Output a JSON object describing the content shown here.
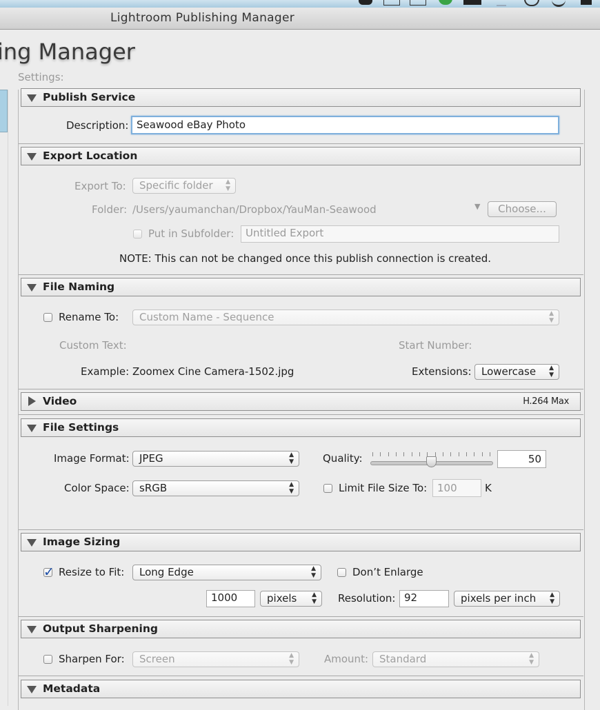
{
  "window": {
    "title": "Lightroom Publishing Manager",
    "big_title": "ing Manager",
    "settings_label": "Settings:"
  },
  "publish_service": {
    "header": "Publish Service",
    "description_label": "Description:",
    "description_value": "Seawood eBay Photo"
  },
  "export_location": {
    "header": "Export Location",
    "export_to_label": "Export To:",
    "export_to_value": "Specific folder",
    "folder_label": "Folder:",
    "folder_path": "/Users/yaumanchan/Dropbox/YauMan-Seawood",
    "choose_button": "Choose...",
    "subfolder_label": "Put in Subfolder:",
    "subfolder_value": "Untitled Export",
    "note": "NOTE: This can not be changed once this publish connection is created."
  },
  "file_naming": {
    "header": "File Naming",
    "rename_label": "Rename To:",
    "rename_value": "Custom Name - Sequence",
    "custom_text_label": "Custom Text:",
    "start_number_label": "Start Number:",
    "example_label": "Example:",
    "example_value": "Zoomex Cine Camera-1502.jpg",
    "extensions_label": "Extensions:",
    "extensions_value": "Lowercase"
  },
  "video": {
    "header": "Video",
    "summary": "H.264 Max"
  },
  "file_settings": {
    "header": "File Settings",
    "image_format_label": "Image Format:",
    "image_format_value": "JPEG",
    "quality_label": "Quality:",
    "quality_value": "50",
    "color_space_label": "Color Space:",
    "color_space_value": "sRGB",
    "limit_label": "Limit File Size To:",
    "limit_value": "100",
    "limit_unit": "K"
  },
  "image_sizing": {
    "header": "Image Sizing",
    "resize_label": "Resize to Fit:",
    "resize_value": "Long Edge",
    "dont_enlarge_label": "Don’t Enlarge",
    "size_value": "1000",
    "size_unit": "pixels",
    "resolution_label": "Resolution:",
    "resolution_value": "92",
    "resolution_unit": "pixels per inch"
  },
  "output_sharpening": {
    "header": "Output Sharpening",
    "sharpen_label": "Sharpen For:",
    "sharpen_value": "Screen",
    "amount_label": "Amount:",
    "amount_value": "Standard"
  },
  "metadata": {
    "header": "Metadata"
  },
  "colors": {
    "focus_ring": "#7fb0dc",
    "checkmark": "#1e4fa8"
  }
}
